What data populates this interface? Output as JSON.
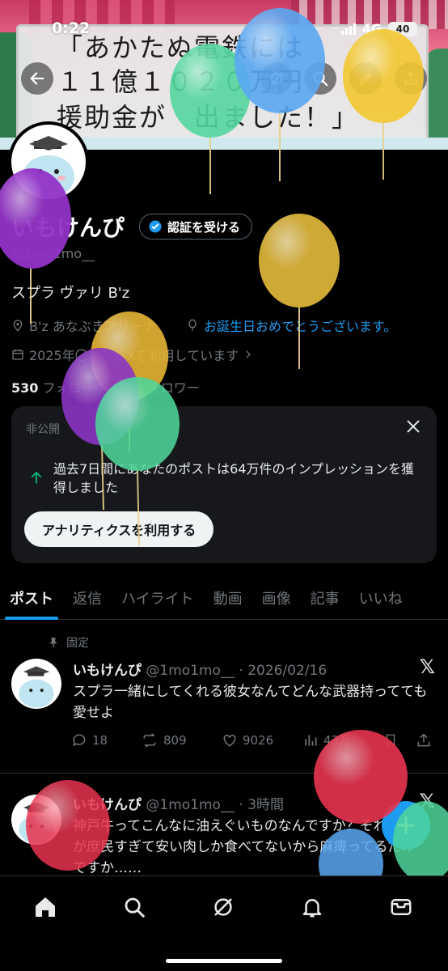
{
  "status_bar": {
    "time": "0:22",
    "network": "4G",
    "battery": "40"
  },
  "banner": {
    "line1": "「あかたぬ電鉄には",
    "line2": "１１億１０２０万円",
    "line3": "援助金が　出ました！」"
  },
  "header_icons": [
    "back-icon",
    "grok-icon",
    "search-icon",
    "edit-icon",
    "share-icon"
  ],
  "profile": {
    "display_name": "いもけんぴ",
    "verify_label": "認証を受ける",
    "handle": "@1mo1mo__",
    "bio": "スプラ ヴァリ B'z",
    "location": "B'z あなぶきアリーナ",
    "birthday": "お誕生日おめでとうございます。",
    "joined": "2025年〇〇からXを利用しています",
    "following_count": "530",
    "following_label": "フォロー中",
    "followers_count": "6",
    "followers_label": "フォロワー"
  },
  "analytics_card": {
    "private_label": "非公開",
    "message": "過去7日間にあなたのポストは64万件のインプレッションを獲得しました",
    "button_label": "アナリティクスを利用する"
  },
  "tabs": [
    "ポスト",
    "返信",
    "ハイライト",
    "動画",
    "画像",
    "記事",
    "いいね"
  ],
  "posts": [
    {
      "pinned_label": "固定",
      "name": "いもけんぴ",
      "handle": "@1mo1mo__",
      "time": "2026/02/16",
      "text": "スプラ一緒にしてくれる彼女なんてどんな武器持ってても愛せよ",
      "replies": "18",
      "reposts": "809",
      "likes": "9026",
      "views": "43万"
    },
    {
      "name": "いもけんぴ",
      "handle": "@1mo1mo__",
      "time": "3時間",
      "text": "神戸牛ってこんなに油えぐいものなんですか？それとも私が庶民すぎて安い肉しか食べてないから麻痺ってるだけですか……"
    }
  ],
  "nav": [
    "home-icon",
    "search-icon",
    "grok-icon",
    "notifications-icon",
    "messages-icon"
  ],
  "colors": {
    "accent": "#1d9bf0",
    "background": "#000000",
    "card": "#16181c",
    "muted": "#71767b"
  }
}
